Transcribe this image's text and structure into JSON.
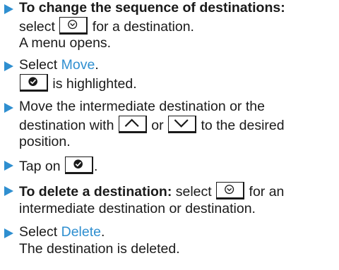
{
  "colors": {
    "bullet": "#2f8fd0",
    "link": "#2f8fd0",
    "text": "#1a1a1a"
  },
  "icons": {
    "bullet": "triangle-right-icon",
    "option_key": "circle-chevron-down-icon",
    "confirm_key": "checkmark-circle-icon",
    "up_key": "chevron-up-icon",
    "down_key": "chevron-down-icon"
  },
  "steps": [
    {
      "heading": "To change the sequence of destinations:",
      "l2_pre": "select",
      "l2_post": "for a destination.",
      "l3": "A menu opens."
    },
    {
      "pre": "Select ",
      "link": "Move",
      "post": ".",
      "l2_post": "is highlighted."
    },
    {
      "l1": "Move the intermediate destination or the",
      "l2_a": "destination with",
      "l2_b": "or",
      "l2_c": "to the desired",
      "l3": "position."
    },
    {
      "pre": "Tap on",
      "post": "."
    },
    {
      "bold": "To delete a destination:",
      "l1_a": " select",
      "l1_b": "for an",
      "l2": "intermediate destination or destination."
    },
    {
      "pre": "Select ",
      "link": "Delete",
      "post": ".",
      "l2": "The destination is deleted."
    }
  ]
}
